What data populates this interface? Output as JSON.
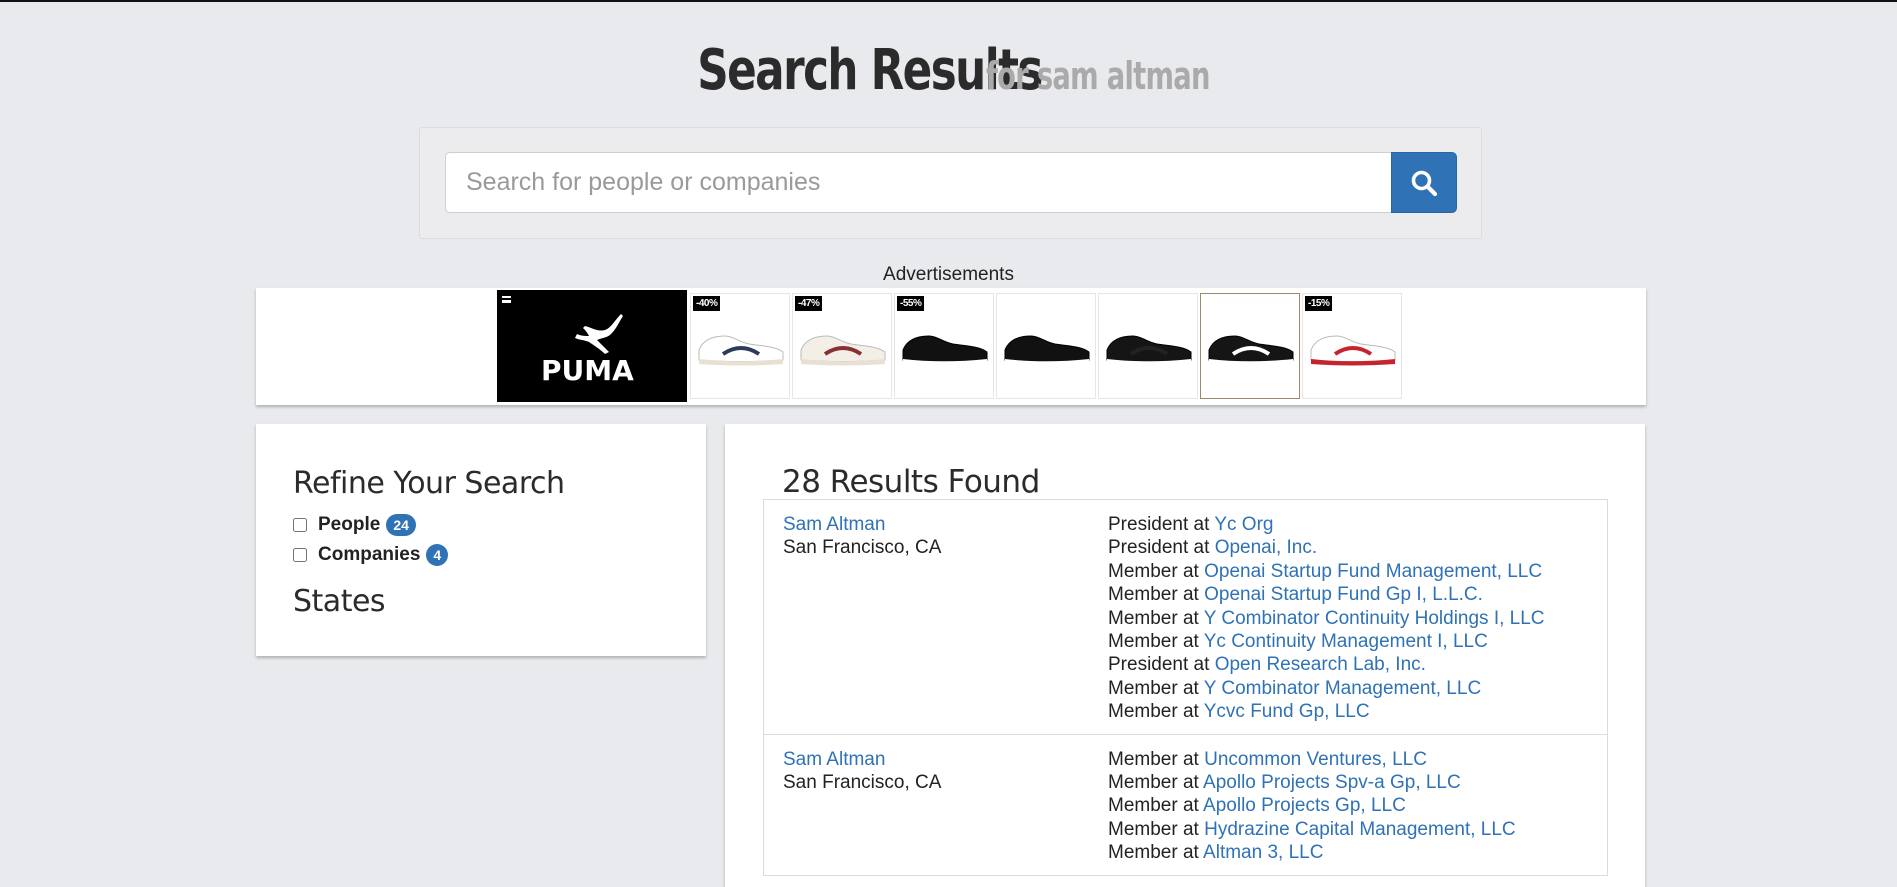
{
  "header": {
    "title": "Search Results",
    "subtitle": "for sam altman"
  },
  "search": {
    "placeholder": "Search for people or companies",
    "value": "",
    "button_icon": "search-icon"
  },
  "ads": {
    "label": "Advertisements",
    "brand": "PUMA",
    "products": [
      {
        "discount": "-40%",
        "color": "#ffffff",
        "accent": "#2c3a5e"
      },
      {
        "discount": "-47%",
        "color": "#f3efe6",
        "accent": "#8a2e36"
      },
      {
        "discount": "-55%",
        "color": "#111111",
        "accent": "#111111"
      },
      {
        "discount": "",
        "color": "#111111",
        "accent": "#111111"
      },
      {
        "discount": "",
        "color": "#151515",
        "accent": "#222222"
      },
      {
        "discount": "",
        "color": "#151515",
        "accent": "#ffffff"
      },
      {
        "discount": "-15%",
        "color": "#ffffff",
        "accent": "#c8232c"
      }
    ]
  },
  "refine": {
    "title": "Refine Your Search",
    "filters": [
      {
        "label": "People",
        "count": "24",
        "checked": false
      },
      {
        "label": "Companies",
        "count": "4",
        "checked": false
      }
    ],
    "states_title": "States"
  },
  "results": {
    "heading": "28 Results Found",
    "items": [
      {
        "name": "Sam Altman",
        "location": "San Francisco, CA",
        "roles": [
          {
            "role": "President at",
            "company": "Yc Org"
          },
          {
            "role": "President at",
            "company": "Openai, Inc."
          },
          {
            "role": "Member at",
            "company": "Openai Startup Fund Management, LLC"
          },
          {
            "role": "Member at",
            "company": "Openai Startup Fund Gp I, L.L.C."
          },
          {
            "role": "Member at",
            "company": "Y Combinator Continuity Holdings I, LLC"
          },
          {
            "role": "Member at",
            "company": "Yc Continuity Management I, LLC"
          },
          {
            "role": "President at",
            "company": "Open Research Lab, Inc."
          },
          {
            "role": "Member at",
            "company": "Y Combinator Management, LLC"
          },
          {
            "role": "Member at",
            "company": "Ycvc Fund Gp, LLC"
          }
        ]
      },
      {
        "name": "Sam Altman",
        "location": "San Francisco, CA",
        "roles": [
          {
            "role": "Member at",
            "company": "Uncommon Ventures, LLC"
          },
          {
            "role": "Member at",
            "company": "Apollo Projects Spv-a Gp, LLC"
          },
          {
            "role": "Member at",
            "company": "Apollo Projects Gp, LLC"
          },
          {
            "role": "Member at",
            "company": "Hydrazine Capital Management, LLC"
          },
          {
            "role": "Member at",
            "company": "Altman 3, LLC"
          }
        ]
      }
    ]
  },
  "colors": {
    "link": "#2f72b5",
    "badge": "#2f72b5",
    "background": "#e9eaed"
  }
}
